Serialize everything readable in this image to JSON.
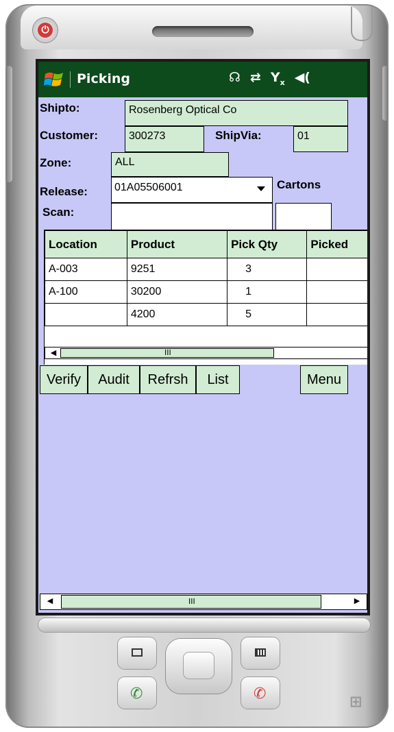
{
  "titlebar": {
    "title": "Picking",
    "icons": [
      "connectivity-icon",
      "sync-icon",
      "no-signal-icon",
      "volume-icon"
    ]
  },
  "form": {
    "shipto_label": "Shipto:",
    "shipto_value": "Rosenberg Optical Co",
    "customer_label": "Customer:",
    "customer_value": "300273",
    "shipvia_label": "ShipVia:",
    "shipvia_value": "01",
    "zone_label": "Zone:",
    "zone_value": "ALL",
    "release_label": "Release:",
    "release_value": "01A05506001",
    "cartons_label": "Cartons",
    "cartons_value": "",
    "scan_label": "Scan:",
    "scan_value": ""
  },
  "grid": {
    "columns": [
      "Location",
      "Product",
      "Pick Qty",
      "Picked"
    ],
    "rows": [
      [
        "A-003",
        "9251",
        "3",
        ""
      ],
      [
        "A-100",
        "30200",
        "1",
        ""
      ],
      [
        "",
        "4200",
        "5",
        ""
      ]
    ],
    "scroll_grip": "III"
  },
  "buttons": {
    "verify": "Verify",
    "audit": "Audit",
    "refresh": "Refrsh",
    "list": "List",
    "menu": "Menu"
  },
  "page_scroll": {
    "grip": "III"
  },
  "colors": {
    "titlebar_bg": "#0d4a1c",
    "screen_bg": "#c8c8f8",
    "field_bg": "#d1ecd3"
  }
}
